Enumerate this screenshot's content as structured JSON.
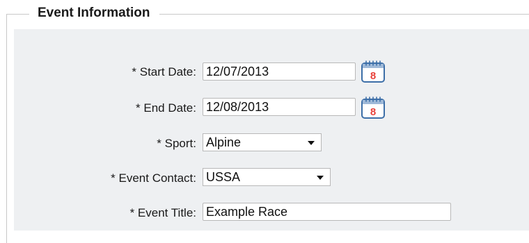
{
  "section": {
    "legend": "Event Information"
  },
  "fields": {
    "start_date": {
      "label": "* Start Date:",
      "value": "12/07/2013",
      "calendar_day": "8",
      "calendar_icon": "calendar-icon"
    },
    "end_date": {
      "label": "* End Date:",
      "value": "12/08/2013",
      "calendar_day": "8",
      "calendar_icon": "calendar-icon"
    },
    "sport": {
      "label": "* Sport:",
      "selected": "Alpine",
      "arrow_icon": "dropdown-arrow-icon"
    },
    "event_contact": {
      "label": "* Event Contact:",
      "selected": "USSA",
      "arrow_icon": "dropdown-arrow-icon"
    },
    "event_title": {
      "label": "* Event Title:",
      "value": "Example Race"
    }
  },
  "colors": {
    "panel_bg": "#eef0f2",
    "calendar_accent": "#3d6fa8",
    "calendar_number": "#e8413a"
  }
}
